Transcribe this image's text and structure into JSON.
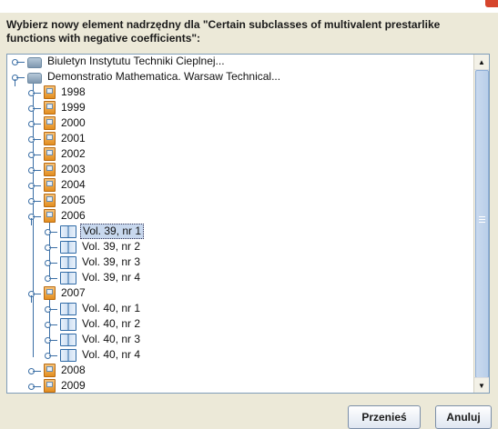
{
  "dialog": {
    "prompt_line1": "Wybierz nowy element nadrzędny dla \"Certain subclasses of multivalent prestarlike",
    "prompt_line2": "functions with negative coefficients\":"
  },
  "tree": {
    "root1": "Biuletyn Instytutu Techniki Cieplnej...",
    "root2": "Demonstratio Mathematica. Warsaw Technical...",
    "years": [
      "1998",
      "1999",
      "2000",
      "2001",
      "2002",
      "2003",
      "2004",
      "2005",
      "2006"
    ],
    "vols2006": [
      "Vol. 39, nr 1",
      "Vol. 39, nr 2",
      "Vol. 39, nr 3",
      "Vol. 39, nr 4"
    ],
    "year2007": "2007",
    "vols2007": [
      "Vol. 40, nr 1",
      "Vol. 40, nr 2",
      "Vol. 40, nr 3",
      "Vol. 40, nr 4"
    ],
    "year2008": "2008",
    "year2009": "2009"
  },
  "buttons": {
    "move": "Przenieś",
    "cancel": "Anuluj"
  },
  "icons": {
    "journal": "database-icon",
    "year": "folder-year-icon",
    "volume": "book-icon"
  }
}
